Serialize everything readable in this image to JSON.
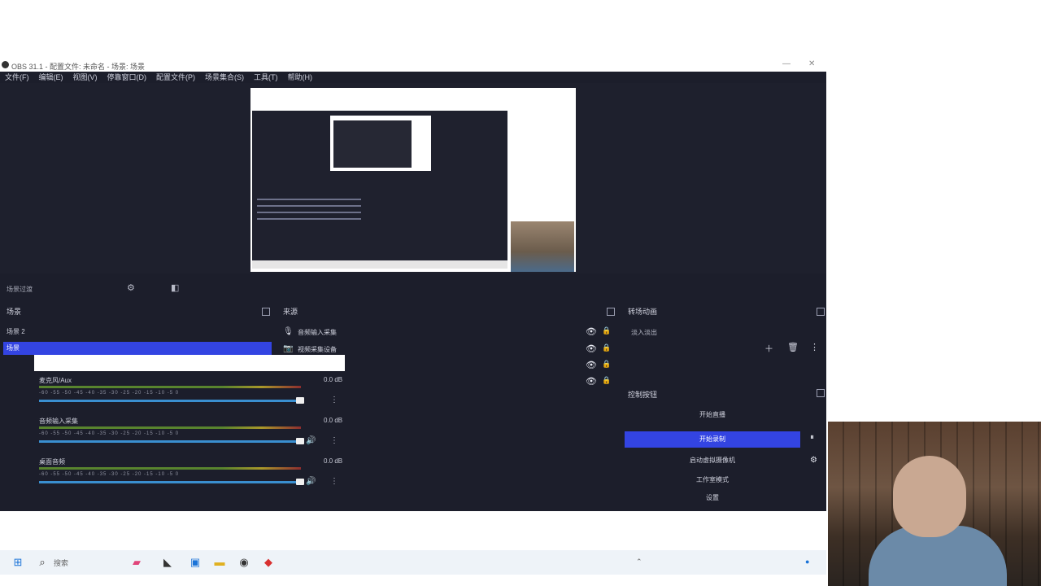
{
  "window": {
    "title": "OBS 31.1 - 配置文件: 未命名 - 场景: 场景",
    "minimize": "—",
    "close": "✕"
  },
  "menu": [
    "文件(F)",
    "编辑(E)",
    "视图(V)",
    "停靠窗口(D)",
    "配置文件(P)",
    "场景集合(S)",
    "工具(T)",
    "帮助(H)"
  ],
  "toolbar": {
    "label": "场景过渡"
  },
  "scenes": {
    "title": "场景",
    "items": [
      {
        "label": "场景 2"
      },
      {
        "label": "场景"
      }
    ]
  },
  "sources": {
    "title": "来源",
    "items": [
      {
        "icon": "🎙",
        "label": "音频输入采集"
      },
      {
        "icon": "📷",
        "label": "视频采集设备"
      },
      {
        "icon": "",
        "label": ""
      },
      {
        "icon": "",
        "label": ""
      }
    ]
  },
  "mixer": {
    "channels": [
      {
        "name": "麦克风/Aux",
        "db": "0.0 dB"
      },
      {
        "name": "音频输入采集",
        "db": "0.0 dB"
      },
      {
        "name": "桌面音频",
        "db": "0.0 dB"
      }
    ],
    "ticks": "-60  -55  -50  -45  -40  -35  -30  -25  -20  -15  -10  -5  0"
  },
  "transitions": {
    "title": "转场动画",
    "selected": "淡入淡出"
  },
  "controls": {
    "title": "控制按钮",
    "start_stream": "开始直播",
    "start_record": "开始录制",
    "virtual_cam": "启动虚拟摄像机",
    "studio_mode": "工作室模式",
    "settings": "设置"
  },
  "taskbar": {
    "search": "搜索"
  }
}
